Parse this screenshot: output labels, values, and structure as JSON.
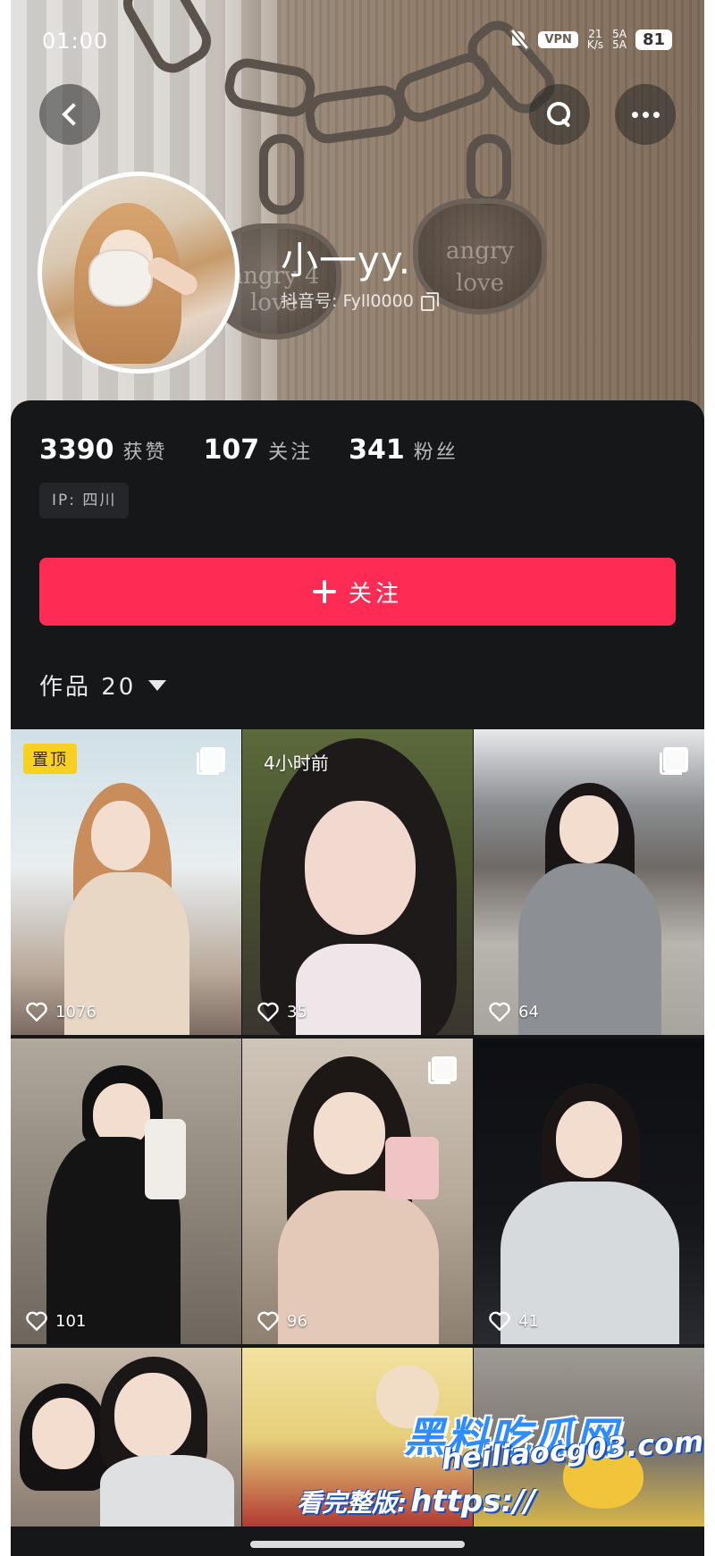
{
  "status_bar": {
    "time": "01:00",
    "vpn_label": "VPN",
    "speed_value": "21",
    "speed_unit": "K/s",
    "signal_1": "5A",
    "signal_2": "5A",
    "battery": "81"
  },
  "profile": {
    "name": "小一yy.",
    "handle": "抖音号: Fyll0000",
    "cover_charm_text_1": "angry",
    "cover_charm_text_2": "love",
    "cover_charm_text_3": "angry 4 love"
  },
  "stats": [
    {
      "value": "3390",
      "label": "获赞"
    },
    {
      "value": "107",
      "label": "关注"
    },
    {
      "value": "341",
      "label": "粉丝"
    }
  ],
  "ip_label": "IP: 四川",
  "follow_button": "关注",
  "works_tab": "作品 20",
  "posts": [
    {
      "likes": "1076",
      "badge": "置顶",
      "multi": true
    },
    {
      "likes": "35",
      "timestamp": "4小时前"
    },
    {
      "likes": "64",
      "multi": true
    },
    {
      "likes": "101"
    },
    {
      "likes": "96",
      "multi": true
    },
    {
      "likes": "41"
    },
    {
      "likes": ""
    },
    {
      "likes": ""
    },
    {
      "likes": ""
    }
  ],
  "watermark": {
    "title": "黑料吃瓜网",
    "prefix": "看完整版:",
    "url_1": "https://",
    "url_2": "heiliaocg03.com"
  },
  "colors": {
    "accent": "#fe2c55",
    "pinned_badge": "#f8d021",
    "background": "#161719"
  }
}
